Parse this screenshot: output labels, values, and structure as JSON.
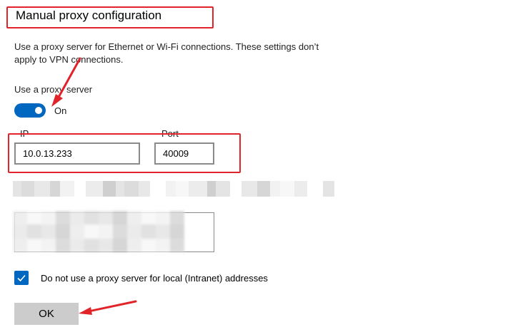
{
  "page": {
    "heading": "Manual proxy configuration",
    "description": "Use a proxy server for Ethernet or Wi-Fi connections. These settings don’t apply to VPN connections."
  },
  "proxy_toggle": {
    "label": "Use a proxy server",
    "state": "On",
    "on": true
  },
  "ip": {
    "label": "IP",
    "value": "10.0.13.233"
  },
  "port": {
    "label": "Port",
    "value": "40009"
  },
  "local_bypass": {
    "checked": true,
    "label": "Do not use a proxy server for local (Intranet) addresses"
  },
  "ok_button": {
    "label": "OK"
  },
  "colors": {
    "accent": "#0067c0",
    "annotation_red": "#e1242a",
    "button_gray": "#cccccc"
  },
  "icons": {
    "checkbox": "checkmark-icon",
    "annotation": "red-arrow-icon"
  }
}
